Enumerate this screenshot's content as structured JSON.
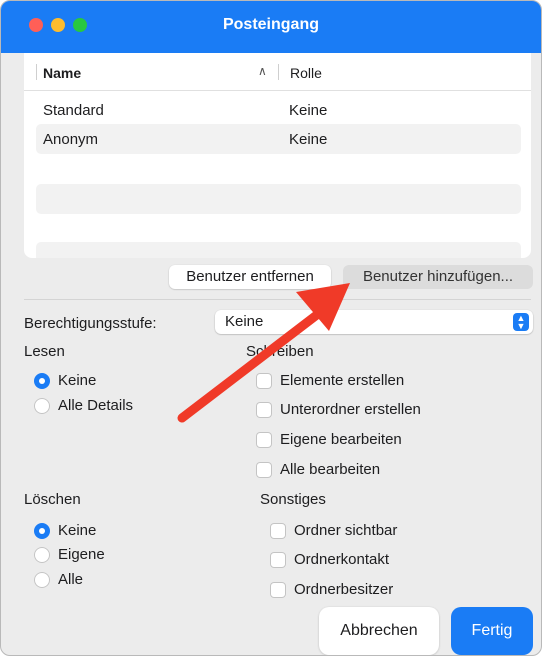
{
  "window": {
    "title": "Posteingang"
  },
  "user_list": {
    "columns": {
      "name": "Name",
      "role": "Rolle"
    },
    "rows": [
      {
        "name": "Standard",
        "role": "Keine"
      },
      {
        "name": "Anonym",
        "role": "Keine"
      }
    ]
  },
  "buttons": {
    "remove_user": "Benutzer entfernen",
    "add_user": "Benutzer hinzufügen...",
    "cancel": "Abbrechen",
    "done": "Fertig"
  },
  "permission_level": {
    "label": "Berechtigungsstufe:",
    "value": "Keine"
  },
  "read": {
    "label": "Lesen",
    "options": [
      {
        "label": "Keine",
        "selected": true
      },
      {
        "label": "Alle Details",
        "selected": false
      }
    ]
  },
  "write": {
    "label": "Schreiben",
    "options": [
      {
        "label": "Elemente erstellen",
        "checked": false
      },
      {
        "label": "Unterordner erstellen",
        "checked": false
      },
      {
        "label": "Eigene bearbeiten",
        "checked": false
      },
      {
        "label": "Alle bearbeiten",
        "checked": false
      }
    ]
  },
  "delete": {
    "label": "Löschen",
    "options": [
      {
        "label": "Keine",
        "selected": true
      },
      {
        "label": "Eigene",
        "selected": false
      },
      {
        "label": "Alle",
        "selected": false
      }
    ]
  },
  "other": {
    "label": "Sonstiges",
    "options": [
      {
        "label": "Ordner sichtbar",
        "checked": false
      },
      {
        "label": "Ordnerkontakt",
        "checked": false
      },
      {
        "label": "Ordnerbesitzer",
        "checked": false
      }
    ]
  },
  "colors": {
    "accent": "#1a7cf5",
    "annotation_arrow": "#f03a28"
  }
}
